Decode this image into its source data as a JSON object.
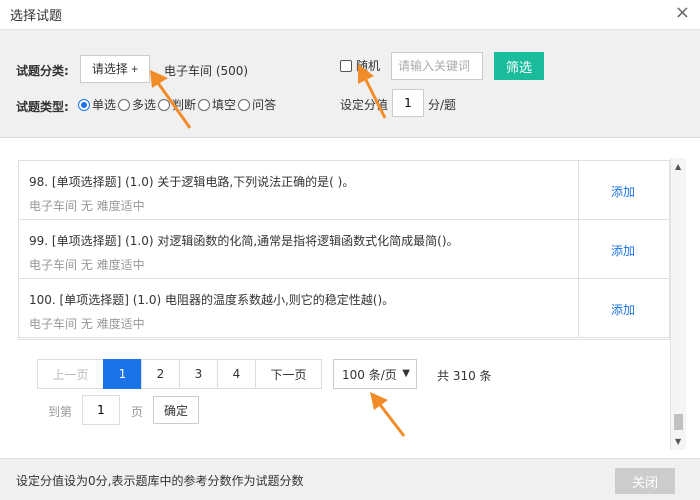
{
  "dialog": {
    "title": "选择试题",
    "close_symbol": "×"
  },
  "filter": {
    "category_label": "试题分类:",
    "select_button": "请选择 +",
    "category_value": "电子车间 (500)",
    "type_label": "试题类型:",
    "types": [
      {
        "label": "单选",
        "selected": true
      },
      {
        "label": "多选",
        "selected": false
      },
      {
        "label": "判断",
        "selected": false
      },
      {
        "label": "填空",
        "selected": false
      },
      {
        "label": "问答",
        "selected": false
      }
    ],
    "random_label": "随机",
    "random_checked": false,
    "keyword_placeholder": "请输入关键词",
    "filter_button": "筛选",
    "score_label": "设定分值",
    "score_value": "1",
    "score_unit": "分/题",
    "filter_button_color": "#1abc9c"
  },
  "questions": [
    {
      "text": "98. [单项选择题] (1.0) 关于逻辑电路,下列说法正确的是( )。",
      "meta": "电子车间  无  难度适中",
      "action": "添加"
    },
    {
      "text": "99. [单项选择题] (1.0) 对逻辑函数的化简,通常是指将逻辑函数式化简成最简()。",
      "meta": "电子车间  无  难度适中",
      "action": "添加"
    },
    {
      "text": "100. [单项选择题] (1.0) 电阻器的温度系数越小,则它的稳定性越()。",
      "meta": "电子车间  无  难度适中",
      "action": "添加"
    }
  ],
  "pagination": {
    "prev": "上一页",
    "pages": [
      "1",
      "2",
      "3",
      "4"
    ],
    "current_page": "1",
    "next": "下一页",
    "page_size": "100 条/页",
    "total": "共 310 条",
    "goto_label": "到第",
    "goto_value": "1",
    "goto_unit": "页",
    "confirm": "确定",
    "active_color": "#1a73e8"
  },
  "footer": {
    "note": "设定分值设为0分,表示题库中的参考分数作为试题分数",
    "close_button": "关闭"
  },
  "annotation_color": "#f28c28"
}
